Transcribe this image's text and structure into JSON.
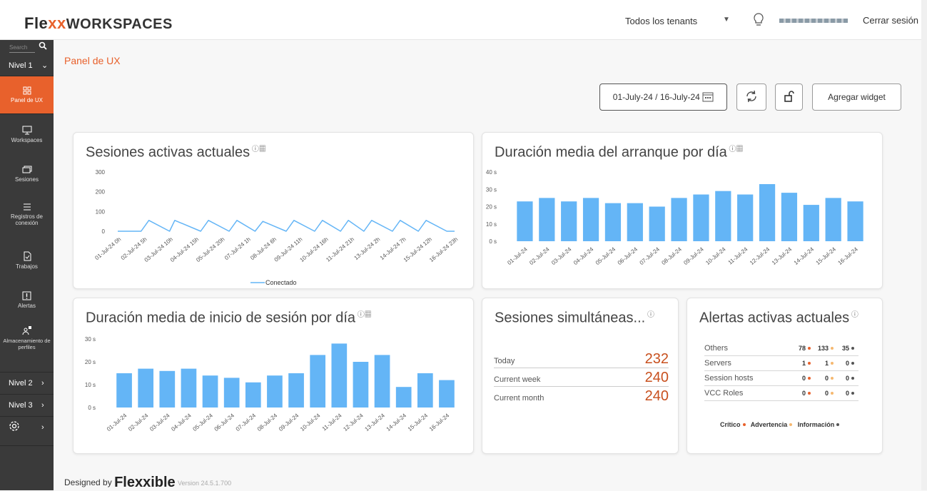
{
  "header": {
    "logo_part1": "Fle",
    "logo_part2": "xx",
    "logo_part3": "WORKSPACES",
    "tenant_select": "Todos los tenants",
    "logout": "Cerrar sesión"
  },
  "sidebar": {
    "search_placeholder": "Search",
    "level1": "Nivel 1",
    "items": [
      {
        "label": "Panel de UX",
        "icon": "dashboard-icon"
      },
      {
        "label": "Workspaces",
        "icon": "monitor-icon"
      },
      {
        "label": "Sesiones",
        "icon": "sessions-icon"
      },
      {
        "label": "Registros de conexión",
        "icon": "list-icon"
      },
      {
        "label": "Trabajos",
        "icon": "job-icon"
      },
      {
        "label": "Alertas",
        "icon": "alert-icon"
      },
      {
        "label": "Almacenamiento de perfiles",
        "icon": "profile-storage-icon"
      }
    ],
    "level2": "Nivel 2",
    "level3": "Nivel 3"
  },
  "page": {
    "breadcrumb": "Panel de UX",
    "date_range": "01-July-24 / 16-July-24",
    "add_widget": "Agregar widget"
  },
  "widgets": {
    "active_sessions": {
      "title": "Sesiones activas actuales",
      "legend": "Conectado"
    },
    "boot_duration": {
      "title": "Duración media del arranque por día"
    },
    "login_duration": {
      "title": "Duración media de inicio de sesión por día"
    },
    "concurrent": {
      "title": "Sesiones simultáneas...",
      "rows": [
        {
          "label": "Today",
          "value": "232"
        },
        {
          "label": "Current week",
          "value": "240"
        },
        {
          "label": "Current month",
          "value": "240"
        }
      ]
    },
    "alerts": {
      "title": "Alertas activas actuales",
      "rows": [
        {
          "label": "Others",
          "critical": "78",
          "warning": "133",
          "info": "35"
        },
        {
          "label": "Servers",
          "critical": "1",
          "warning": "1",
          "info": "0"
        },
        {
          "label": "Session hosts",
          "critical": "0",
          "warning": "0",
          "info": "0"
        },
        {
          "label": "VCC Roles",
          "critical": "0",
          "warning": "0",
          "info": "0"
        }
      ],
      "legend": {
        "critical": "Crítico",
        "warning": "Advertencia",
        "info": "Información"
      },
      "colors": {
        "critical": "#e8612c",
        "warning": "#f5b870",
        "info": "#555555"
      }
    }
  },
  "footer": {
    "designed_by": "Designed by",
    "brand": "Flexxible",
    "version": "Version 24.5.1.700"
  },
  "colors": {
    "accent": "#e8612c",
    "bar": "#64b5f6",
    "sidebar": "#3a3a3a"
  },
  "chart_data": [
    {
      "type": "line",
      "title": "Sesiones activas actuales",
      "categories": [
        "01-Jul-24 0h",
        "02-Jul-24 5h",
        "03-Jul-24 10h",
        "04-Jul-24 15h",
        "05-Jul-24 20h",
        "07-Jul-24 1h",
        "08-Jul-24 6h",
        "09-Jul-24 11h",
        "10-Jul-24 16h",
        "11-Jul-24 21h",
        "13-Jul-24 2h",
        "14-Jul-24 7h",
        "15-Jul-24 12h",
        "16-Jul-24 23h"
      ],
      "yticks": [
        "300",
        "200",
        "100",
        "0"
      ],
      "ylim": [
        0,
        300
      ],
      "series": [
        {
          "name": "Conectado",
          "x": [
            0,
            0.9,
            1.2,
            2,
            2.2,
            3.2,
            3.5,
            4.3,
            4.6,
            5.3,
            5.6,
            6.5,
            6.8,
            7.6,
            7.9,
            8.6,
            8.9,
            9.5,
            9.8,
            10.6,
            10.9,
            11.6,
            11.9,
            12.7,
            13
          ],
          "values": [
            0,
            0,
            55,
            0,
            55,
            0,
            55,
            0,
            55,
            0,
            50,
            0,
            55,
            0,
            55,
            0,
            55,
            0,
            55,
            0,
            55,
            0,
            55,
            0,
            0
          ]
        }
      ]
    },
    {
      "type": "bar",
      "title": "Duración media del arranque por día",
      "categories": [
        "01-Jul-24",
        "02-Jul-24",
        "03-Jul-24",
        "04-Jul-24",
        "05-Jul-24",
        "06-Jul-24",
        "07-Jul-24",
        "08-Jul-24",
        "09-Jul-24",
        "10-Jul-24",
        "11-Jul-24",
        "12-Jul-24",
        "13-Jul-24",
        "14-Jul-24",
        "15-Jul-24",
        "16-Jul-24"
      ],
      "values": [
        23,
        25,
        23,
        25,
        22,
        22,
        20,
        25,
        27,
        29,
        27,
        33,
        28,
        21,
        25,
        23
      ],
      "yticks": [
        "40 s",
        "30 s",
        "20 s",
        "10 s",
        "0 s"
      ],
      "ylim": [
        0,
        40
      ]
    },
    {
      "type": "bar",
      "title": "Duración media de inicio de sesión por día",
      "categories": [
        "01-Jul-24",
        "02-Jul-24",
        "03-Jul-24",
        "04-Jul-24",
        "05-Jul-24",
        "06-Jul-24",
        "07-Jul-24",
        "08-Jul-24",
        "09-Jul-24",
        "10-Jul-24",
        "11-Jul-24",
        "12-Jul-24",
        "13-Jul-24",
        "14-Jul-24",
        "15-Jul-24",
        "16-Jul-24"
      ],
      "values": [
        15,
        17,
        16,
        17,
        14,
        13,
        11,
        14,
        15,
        23,
        28,
        20,
        23,
        9,
        15,
        12
      ],
      "yticks": [
        "30 s",
        "20 s",
        "10 s",
        "0 s"
      ],
      "ylim": [
        0,
        30
      ]
    }
  ]
}
